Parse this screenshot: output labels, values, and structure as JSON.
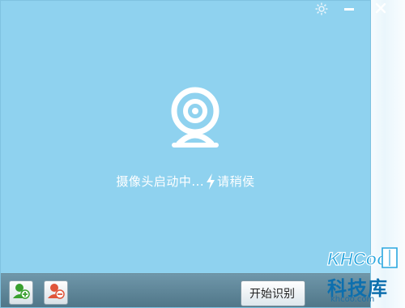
{
  "window": {
    "status_text": "摄像头启动中...",
    "status_wait": "请稍侯"
  },
  "titlebar": {
    "settings_icon": "gear-icon",
    "minimize_icon": "minimize-icon",
    "close_icon": "close-icon"
  },
  "toolbar": {
    "add_user_icon": "add-user-icon",
    "remove_user_icon": "remove-user-icon",
    "start_label": "开始识别"
  },
  "watermark": {
    "logo_text": "KHCoo",
    "title": "科技库",
    "url": "khcoo.com"
  },
  "colors": {
    "background": "#8fd2ef",
    "bottom_bar": "#5a8194",
    "watermark_blue": "#0d6fae"
  }
}
